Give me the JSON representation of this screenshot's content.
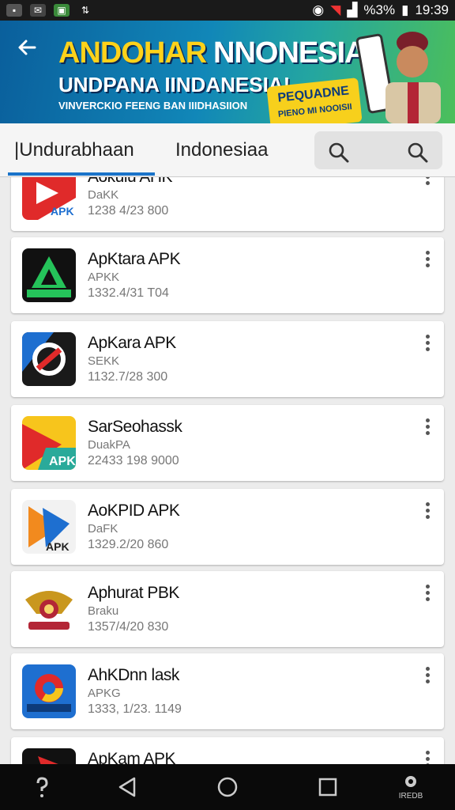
{
  "status_bar": {
    "battery": "%3%",
    "time": "19:39",
    "icons": [
      "sim-icon",
      "mail-icon",
      "photo-icon",
      "usb-icon",
      "hotspot-icon",
      "wifi-icon",
      "signal-icon",
      "battery-icon"
    ]
  },
  "banner": {
    "title_part1": "ANDOHAR",
    "title_part2": "NNONESIA!",
    "subtitle": "UNDPANA IINDANESIA!",
    "tagline": "VINVERCKIO FEENG BAN IIIDHASIION",
    "badge_line1": "PEQUADNE",
    "badge_line2": "PIENO MI NOOISII",
    "colors": {
      "gradient_start": "#0a5f9c",
      "gradient_end": "#4cbf5a",
      "accent": "#ffd21a"
    }
  },
  "tabs": {
    "tab1": "|Undurabhaan",
    "tab2": "Indonesiaa",
    "active_color": "#1a73c9"
  },
  "apps": [
    {
      "name": "Aokuiu AHK",
      "sub": "DaKK",
      "meta": "1238 4/23 800",
      "icon": "apk-red-icon"
    },
    {
      "name": "ApKtara APK",
      "sub": "APKK",
      "meta": "1332.4/31 T04",
      "icon": "apk-green-android-icon"
    },
    {
      "name": "ApKara APK",
      "sub": "SEKK",
      "meta": "1132.7/28 300",
      "icon": "apk-blue-circle-icon"
    },
    {
      "name": "SarSeohassk",
      "sub": "DuakPA",
      "meta": "22433 198 9000",
      "icon": "apk-yellow-red-icon"
    },
    {
      "name": "AoKPID APK",
      "sub": "DaFK",
      "meta": "1329.2/20 860",
      "icon": "apk-blue-orange-icon"
    },
    {
      "name": "Aphurat PBK",
      "sub": "Braku",
      "meta": "1357/4/20 830",
      "icon": "garuda-emblem-icon"
    },
    {
      "name": "AhKDnn lask",
      "sub": "APKG",
      "meta": "1333, 1/23. 1149",
      "icon": "apk-chrome-style-icon"
    },
    {
      "name": "ApKam APK",
      "sub": "",
      "meta": "",
      "icon": "apk-dark-red-icon"
    }
  ],
  "nav_bar": {
    "more_label": "IREDB",
    "icons": [
      "help-icon",
      "back-nav-icon",
      "home-nav-icon",
      "recents-nav-icon",
      "more-nav-icon"
    ]
  }
}
